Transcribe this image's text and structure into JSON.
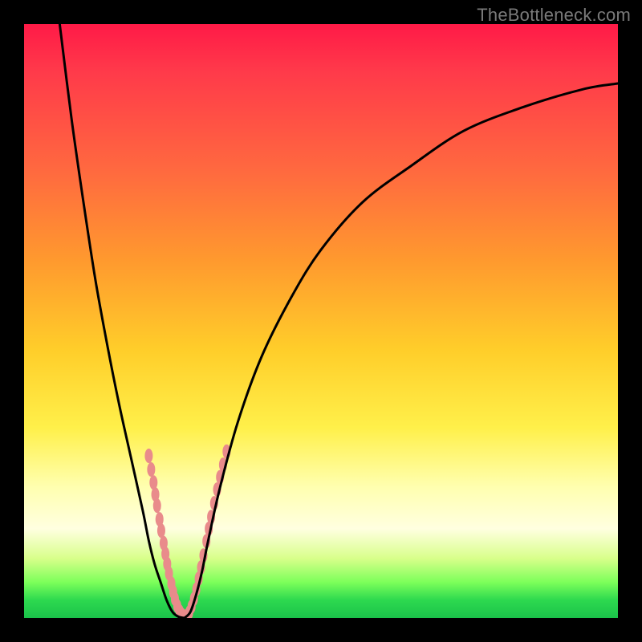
{
  "watermark": "TheBottleneck.com",
  "chart_data": {
    "type": "line",
    "title": "",
    "xlabel": "",
    "ylabel": "",
    "xlim": [
      0,
      100
    ],
    "ylim": [
      0,
      100
    ],
    "series": [
      {
        "name": "curve-left",
        "x": [
          6,
          8,
          10,
          12,
          14,
          16,
          18,
          20,
          21,
          22,
          23,
          24,
          25,
          26,
          27
        ],
        "y": [
          100,
          84,
          70,
          57,
          46,
          36,
          27,
          18,
          13,
          9,
          6,
          3,
          1,
          0.2,
          0
        ]
      },
      {
        "name": "curve-right",
        "x": [
          27,
          28,
          29,
          30,
          31,
          33,
          36,
          40,
          45,
          50,
          57,
          65,
          74,
          84,
          94,
          100
        ],
        "y": [
          0,
          1,
          4,
          8,
          13,
          22,
          33,
          44,
          54,
          62,
          70,
          76,
          82,
          86,
          89,
          90
        ]
      }
    ],
    "markers": {
      "comment": "salmon oblong dots near the V minimum, on both branches",
      "points": [
        [
          21.0,
          27.3
        ],
        [
          21.4,
          25.0
        ],
        [
          21.8,
          22.8
        ],
        [
          22.1,
          20.8
        ],
        [
          22.4,
          18.9
        ],
        [
          22.8,
          16.6
        ],
        [
          23.1,
          14.7
        ],
        [
          23.5,
          12.6
        ],
        [
          23.8,
          10.8
        ],
        [
          24.1,
          9.1
        ],
        [
          24.4,
          7.5
        ],
        [
          24.8,
          5.8
        ],
        [
          25.1,
          4.4
        ],
        [
          25.4,
          3.2
        ],
        [
          25.8,
          2.0
        ],
        [
          26.2,
          1.1
        ],
        [
          26.6,
          0.5
        ],
        [
          27.0,
          0.1
        ],
        [
          27.4,
          0.3
        ],
        [
          27.8,
          0.9
        ],
        [
          28.2,
          1.9
        ],
        [
          28.6,
          3.2
        ],
        [
          29.0,
          4.8
        ],
        [
          29.4,
          6.6
        ],
        [
          29.8,
          8.5
        ],
        [
          30.2,
          10.5
        ],
        [
          30.7,
          12.9
        ],
        [
          31.1,
          15.0
        ],
        [
          31.5,
          17.0
        ],
        [
          32.0,
          19.3
        ],
        [
          32.5,
          21.6
        ],
        [
          33.0,
          23.7
        ],
        [
          33.5,
          25.8
        ],
        [
          34.1,
          28.0
        ]
      ],
      "color": "#e98b8b",
      "rx": 5,
      "ry": 9
    },
    "curve_stroke": "#000000",
    "curve_width": 3
  }
}
